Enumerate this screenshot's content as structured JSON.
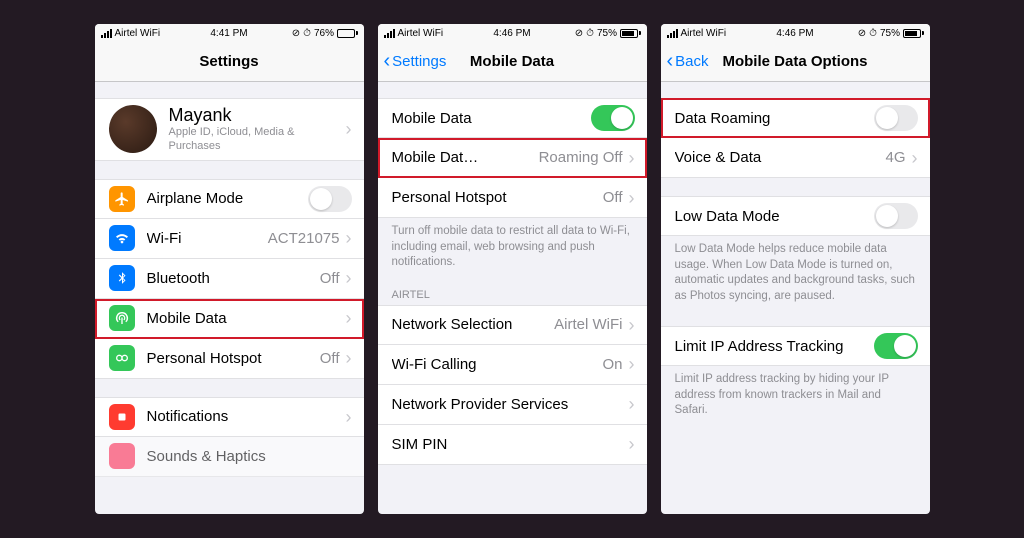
{
  "status": {
    "carrier": "Airtel WiFi",
    "time1": "4:41 PM",
    "time2": "4:46 PM",
    "time3": "4:46 PM",
    "battery1": "76%",
    "battery2": "75%",
    "battery3": "75%",
    "batteryFill1": "76%",
    "batteryFill2": "75%",
    "batteryFill3": "75%",
    "rotation_lock": "⟳",
    "alarm": "●"
  },
  "screen1": {
    "title": "Settings",
    "profile": {
      "name": "Mayank",
      "sub": "Apple ID, iCloud, Media & Purchases"
    },
    "rows": {
      "airplane": "Airplane Mode",
      "wifi": "Wi-Fi",
      "wifi_value": "ACT21075",
      "bluetooth": "Bluetooth",
      "bluetooth_value": "Off",
      "mobile_data": "Mobile Data",
      "hotspot": "Personal Hotspot",
      "hotspot_value": "Off",
      "notifications": "Notifications",
      "sounds": "Sounds & Haptics"
    },
    "colors": {
      "airplane": "#ff9500",
      "wifi": "#007aff",
      "bluetooth": "#007aff",
      "mobile": "#34c759",
      "hotspot": "#34c759",
      "notifications": "#ff3b30",
      "sounds": "#ff2d55"
    }
  },
  "screen2": {
    "back": "Settings",
    "title": "Mobile Data",
    "rows": {
      "mobile_data": "Mobile Data",
      "mobile_options": "Mobile Dat…",
      "mobile_options_value": "Roaming Off",
      "hotspot": "Personal Hotspot",
      "hotspot_value": "Off"
    },
    "footer1": "Turn off mobile data to restrict all data to Wi-Fi, including email, web browsing and push notifications.",
    "section": "AIRTEL",
    "rows2": {
      "network_selection": "Network Selection",
      "network_selection_value": "Airtel WiFi",
      "wifi_calling": "Wi-Fi Calling",
      "wifi_calling_value": "On",
      "network_provider": "Network Provider Services",
      "sim_pin": "SIM PIN"
    }
  },
  "screen3": {
    "back": "Back",
    "title": "Mobile Data Options",
    "rows": {
      "data_roaming": "Data Roaming",
      "voice_data": "Voice & Data",
      "voice_data_value": "4G",
      "low_data": "Low Data Mode",
      "limit_ip": "Limit IP Address Tracking"
    },
    "footer_low": "Low Data Mode helps reduce mobile data usage. When Low Data Mode is turned on, automatic updates and background tasks, such as Photos syncing, are paused.",
    "footer_ip": "Limit IP address tracking by hiding your IP address from known trackers in Mail and Safari."
  }
}
